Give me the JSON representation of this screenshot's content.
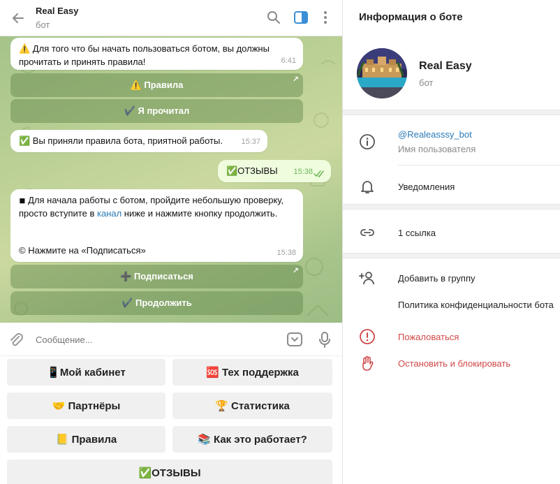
{
  "header": {
    "title": "Real Easy",
    "subtitle": "бот"
  },
  "messages": [
    {
      "text": "⚠️ Для того что бы начать пользоваться ботом, вы должны прочитать и принять правила!",
      "time": "6:41"
    },
    {
      "text": "✅ Вы приняли правила бота, приятной работы.",
      "time": "15:37"
    },
    {
      "text": "✅ОТЗЫВЫ",
      "time": "15:38",
      "outgoing": true
    },
    {
      "text_before_link": "◾ Для начала работы с ботом, пройдите небольшую проверку, просто вступите в ",
      "link": "канал",
      "text_after_link": " ниже и нажмите кнопку продолжить.",
      "note": "© Нажмите на «Подписаться»",
      "time": "15:38"
    }
  ],
  "inline_buttons": {
    "rules": "⚠️ Правила",
    "read": "✔️ Я прочитал",
    "subscribe": "➕ Подписаться",
    "continue": "✔️ Продолжить"
  },
  "composer": {
    "placeholder": "Сообщение..."
  },
  "keyboard": {
    "cabinet": "📱Мой кабинет",
    "support": "🆘 Тех поддержка",
    "partners": "🤝 Партнёры",
    "stats": "🏆 Статистика",
    "rules": "📒 Правила",
    "how": "📚 Как это работает?",
    "reviews": "✅ОТЗЫВЫ"
  },
  "info": {
    "title": "Информация о боте",
    "name": "Real Easy",
    "subtitle": "бот",
    "username": "@Realeasssy_bot",
    "username_label": "Имя пользователя",
    "notifications": "Уведомления",
    "links": "1 ссылка",
    "add_to_group": "Добавить в группу",
    "privacy": "Политика конфиденциальности бота",
    "report": "Пожаловаться",
    "block": "Остановить и блокировать"
  },
  "colors": {
    "accent": "#2a7ab8",
    "danger": "#d04848",
    "chat_bg": "#b5cc90",
    "outgoing_bubble": "#effdde"
  }
}
